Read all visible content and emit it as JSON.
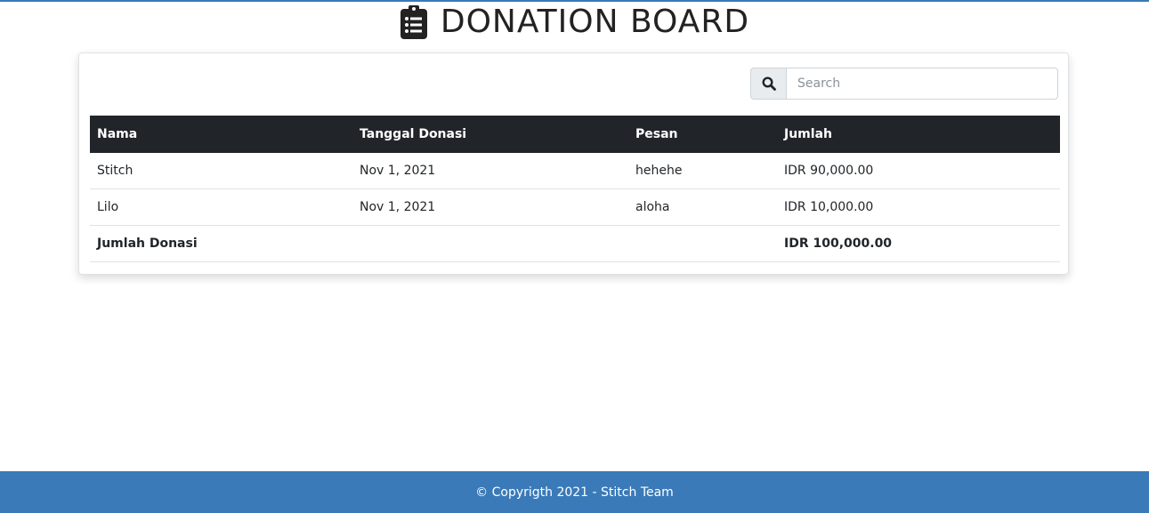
{
  "header": {
    "title": "DONATION BOARD",
    "icon": "clipboard-list-icon"
  },
  "search": {
    "placeholder": "Search",
    "value": "",
    "icon": "search-icon"
  },
  "table": {
    "columns": [
      "Nama",
      "Tanggal Donasi",
      "Pesan",
      "Jumlah"
    ],
    "rows": [
      {
        "nama": "Stitch",
        "tanggal": "Nov 1, 2021",
        "pesan": "hehehe",
        "jumlah": "IDR 90,000.00"
      },
      {
        "nama": "Lilo",
        "tanggal": "Nov 1, 2021",
        "pesan": "aloha",
        "jumlah": "IDR 10,000.00"
      }
    ],
    "total": {
      "label": "Jumlah Donasi",
      "value": "IDR 100,000.00"
    }
  },
  "footer": {
    "text": "© Copyrigth 2021 - Stitch Team"
  },
  "colors": {
    "accent": "#3a7ab8",
    "table_header": "#212529"
  }
}
